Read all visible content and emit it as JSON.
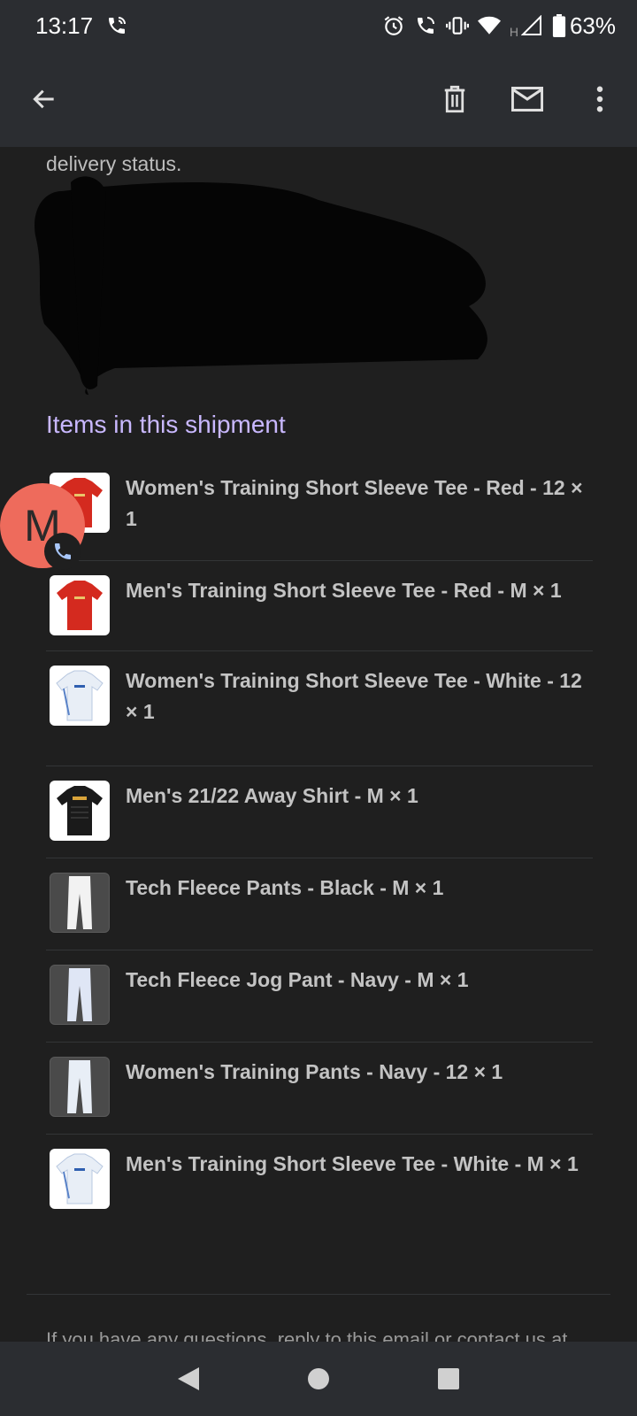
{
  "status_bar": {
    "time": "13:17",
    "network_label": "H",
    "battery_percent": "63%",
    "icons": [
      "wifi-calling-icon",
      "alarm-icon",
      "wifi-calling-icon",
      "vibrate-icon",
      "wifi-icon",
      "signal-icon",
      "battery-icon"
    ]
  },
  "app_bar": {
    "icons": [
      "back-arrow-icon",
      "trash-icon",
      "mail-icon",
      "more-vert-icon"
    ]
  },
  "email": {
    "partial_text": "delivery status.",
    "section_title": "Items in this shipment",
    "items": [
      {
        "name": "Women's Training Short Sleeve Tee - Red - 12 × 1",
        "thumb_color": "#d42a1f"
      },
      {
        "name": "Men's Training Short Sleeve Tee - Red - M × 1",
        "thumb_color": "#d42a1f"
      },
      {
        "name": "Women's Training Short Sleeve Tee - White - 12 × 1",
        "thumb_color": "#e8eef6"
      },
      {
        "name": "Men's 21/22 Away Shirt - M × 1",
        "thumb_color": "#1a1a1a"
      },
      {
        "name": "Tech Fleece Pants - Black - M × 1",
        "thumb_color": "#f2f2f2"
      },
      {
        "name": "Tech Fleece Jog Pant - Navy - M × 1",
        "thumb_color": "#dfe6f5"
      },
      {
        "name": "Women's Training Pants - Navy - 12 × 1",
        "thumb_color": "#e8eef6"
      },
      {
        "name": "Men's Training Short Sleeve Tee - White - M × 1",
        "thumb_color": "#e8eef6"
      }
    ],
    "footer_text": "If you have any questions, reply to this email or contact us at"
  },
  "chat_head": {
    "initial": "M",
    "color": "#ee6b5c"
  },
  "colors": {
    "accent": "#c9b8ff",
    "background": "#1f1f1f",
    "bar": "#2b2d31"
  }
}
